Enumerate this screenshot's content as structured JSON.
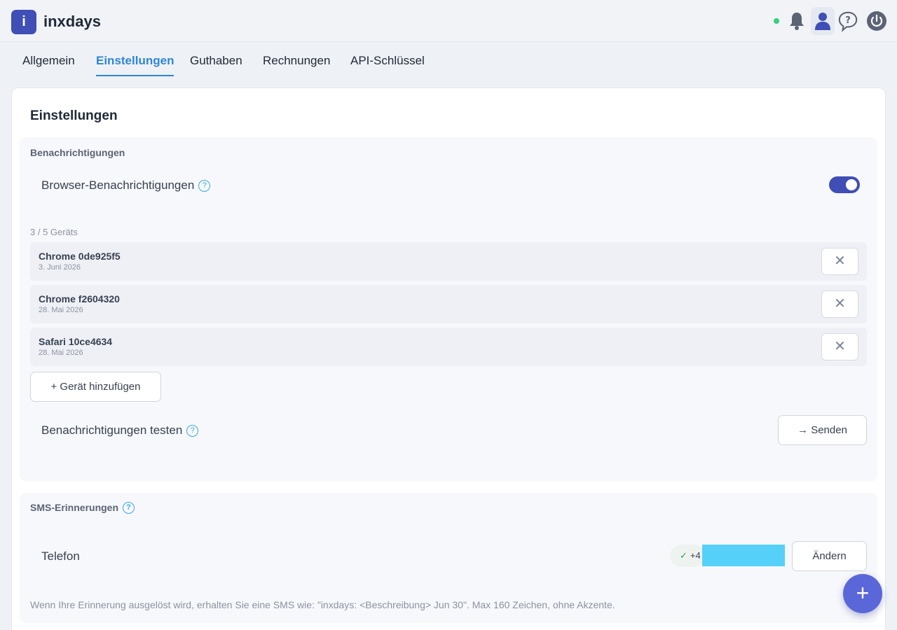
{
  "app": {
    "logo_letter": "i",
    "name": "inxdays"
  },
  "header": {
    "icons": [
      "online-status-dot",
      "bell-icon",
      "user-icon",
      "help-icon",
      "power-icon"
    ],
    "status_color": "#34d07a",
    "accent": "#3f4fb5"
  },
  "tabs": [
    {
      "label": "Allgemein",
      "active": false
    },
    {
      "label": "Einstellungen",
      "active": true
    },
    {
      "label": "Guthaben",
      "active": false
    },
    {
      "label": "Rechnungen",
      "active": false
    },
    {
      "label": "API-Schlüssel",
      "active": false
    }
  ],
  "page": {
    "title": "Einstellungen"
  },
  "notifications": {
    "section_label": "Benachrichtigungen",
    "browser_label": "Browser-Benachrichtigungen",
    "browser_enabled": true,
    "device_count": "3 / 5 Geräts",
    "devices": [
      {
        "name": "Chrome 0de925f5",
        "date": "3. Juni 2026"
      },
      {
        "name": "Chrome f2604320",
        "date": "28. Mai 2026"
      },
      {
        "name": "Safari 10ce4634",
        "date": "28. Mai 2026"
      }
    ],
    "remove_symbol": "✕",
    "add_device_label": "+ Gerät hinzufügen",
    "test_label": "Benachrichtigungen testen",
    "send_label": "→ Senden",
    "help_symbol": "?"
  },
  "sms": {
    "section_label": "SMS-Erinnerungen",
    "phone_label": "Telefon",
    "phone_prefix": "+4",
    "verified_symbol": "✓",
    "change_label": "Ändern",
    "note": "Wenn Ihre Erinnerung ausgelöst wird, erhalten Sie eine SMS wie: \"inxdays: <Beschreibung> Jun 30\". Max 160 Zeichen, ohne Akzente."
  },
  "fab": {
    "symbol": "+"
  }
}
